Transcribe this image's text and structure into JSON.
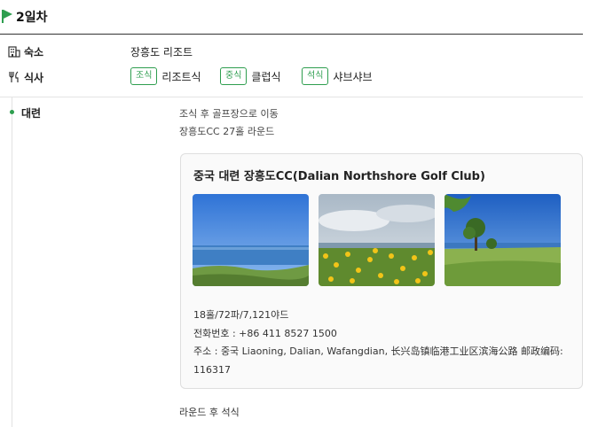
{
  "day": {
    "title": "2일차"
  },
  "accommodation": {
    "label": "숙소",
    "value": "장흥도 리조트",
    "icon": "building-icon"
  },
  "meals": {
    "label": "식사",
    "icon": "fork-knife-icon",
    "items": [
      {
        "badge": "조식",
        "text": "리조트식"
      },
      {
        "badge": "중식",
        "text": "클럽식"
      },
      {
        "badge": "석식",
        "text": "샤브샤브"
      }
    ]
  },
  "schedule": {
    "city": "대련",
    "plan_lines": [
      "조식 후 골프장으로 이동",
      "장흥도CC 27홀 라운드"
    ],
    "after": "라운드 후 석식"
  },
  "golf_club": {
    "title": "중국 대련 장흥도CC(Dalian Northshore Golf Club)",
    "course_info": "18홀/72파/7,121야드",
    "phone": "전화번호 : +86 411 8527 1500",
    "address_line1": "주소 : 중국 Liaoning, Dalian, Wafangdian, 长兴岛镇临港工业区滨海公路 邮政编码:",
    "address_line2": "116317"
  },
  "colors": {
    "accent": "#2e9e4f",
    "header_rule": "#333333",
    "divider": "#e4e4e4"
  }
}
